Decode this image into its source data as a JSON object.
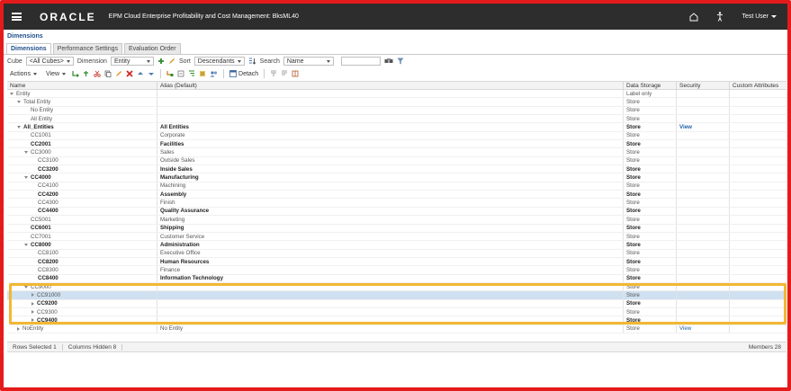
{
  "topbar": {
    "logo": "ORACLE",
    "app_title": "EPM Cloud Enterprise Profitability and Cost Management: BksML40",
    "user": "Test User"
  },
  "page_title": "Dimensions",
  "tabs": [
    {
      "label": "Dimensions",
      "active": true
    },
    {
      "label": "Performance Settings",
      "active": false
    },
    {
      "label": "Evaluation Order",
      "active": false
    }
  ],
  "filters": {
    "cube_label": "Cube",
    "cube_value": "<All Cubes>",
    "dimension_label": "Dimension",
    "dimension_value": "Entity",
    "sort_label": "Sort",
    "sort_value": "Descendants",
    "search_label": "Search",
    "search_value": "Name"
  },
  "toolbar": {
    "actions_label": "Actions",
    "view_label": "View",
    "detach_label": "Detach"
  },
  "table": {
    "columns": [
      "Name",
      "Alias (Default)",
      "Data Storage",
      "Security",
      "Custom Attributes"
    ],
    "rows": [
      {
        "name": "Entity",
        "alias": "",
        "storage": "Label only",
        "security": "",
        "level": 0,
        "toggle": "open",
        "bold": false,
        "selected": false
      },
      {
        "name": "Total Entity",
        "alias": "",
        "storage": "Store",
        "security": "",
        "level": 1,
        "toggle": "open",
        "bold": false,
        "selected": false
      },
      {
        "name": "No Entity",
        "alias": "",
        "storage": "Store",
        "security": "",
        "level": 2,
        "toggle": "none",
        "bold": false,
        "selected": false
      },
      {
        "name": "All Entity",
        "alias": "",
        "storage": "Store",
        "security": "",
        "level": 2,
        "toggle": "none",
        "bold": false,
        "selected": false
      },
      {
        "name": "All_Entities",
        "alias": "All Entities",
        "storage": "Store",
        "security": "View",
        "level": 1,
        "toggle": "open",
        "bold": true,
        "selected": false
      },
      {
        "name": "CC1001",
        "alias": "Corporate",
        "storage": "Store",
        "security": "",
        "level": 2,
        "toggle": "none",
        "bold": false,
        "selected": false
      },
      {
        "name": "CC2001",
        "alias": "Facilities",
        "storage": "Store",
        "security": "",
        "level": 2,
        "toggle": "none",
        "bold": true,
        "selected": false
      },
      {
        "name": "CC3000",
        "alias": "Sales",
        "storage": "Store",
        "security": "",
        "level": 2,
        "toggle": "open",
        "bold": false,
        "selected": false
      },
      {
        "name": "CC3100",
        "alias": "Outside Sales",
        "storage": "Store",
        "security": "",
        "level": 3,
        "toggle": "none",
        "bold": false,
        "selected": false
      },
      {
        "name": "CC3200",
        "alias": "Inside Sales",
        "storage": "Store",
        "security": "",
        "level": 3,
        "toggle": "none",
        "bold": true,
        "selected": false
      },
      {
        "name": "CC4000",
        "alias": "Manufacturing",
        "storage": "Store",
        "security": "",
        "level": 2,
        "toggle": "open",
        "bold": true,
        "selected": false
      },
      {
        "name": "CC4100",
        "alias": "Machining",
        "storage": "Store",
        "security": "",
        "level": 3,
        "toggle": "none",
        "bold": false,
        "selected": false
      },
      {
        "name": "CC4200",
        "alias": "Assembly",
        "storage": "Store",
        "security": "",
        "level": 3,
        "toggle": "none",
        "bold": true,
        "selected": false
      },
      {
        "name": "CC4300",
        "alias": "Finish",
        "storage": "Store",
        "security": "",
        "level": 3,
        "toggle": "none",
        "bold": false,
        "selected": false
      },
      {
        "name": "CC4400",
        "alias": "Quality Assurance",
        "storage": "Store",
        "security": "",
        "level": 3,
        "toggle": "none",
        "bold": true,
        "selected": false
      },
      {
        "name": "CC5001",
        "alias": "Marketing",
        "storage": "Store",
        "security": "",
        "level": 2,
        "toggle": "none",
        "bold": false,
        "selected": false
      },
      {
        "name": "CC6001",
        "alias": "Shipping",
        "storage": "Store",
        "security": "",
        "level": 2,
        "toggle": "none",
        "bold": true,
        "selected": false
      },
      {
        "name": "CC7001",
        "alias": "Customer Service",
        "storage": "Store",
        "security": "",
        "level": 2,
        "toggle": "none",
        "bold": false,
        "selected": false
      },
      {
        "name": "CC8000",
        "alias": "Administration",
        "storage": "Store",
        "security": "",
        "level": 2,
        "toggle": "open",
        "bold": true,
        "selected": false
      },
      {
        "name": "CC8100",
        "alias": "Executive Office",
        "storage": "Store",
        "security": "",
        "level": 3,
        "toggle": "none",
        "bold": false,
        "selected": false
      },
      {
        "name": "CC8200",
        "alias": "Human Resources",
        "storage": "Store",
        "security": "",
        "level": 3,
        "toggle": "none",
        "bold": true,
        "selected": false
      },
      {
        "name": "CC8300",
        "alias": "Finance",
        "storage": "Store",
        "security": "",
        "level": 3,
        "toggle": "none",
        "bold": false,
        "selected": false
      },
      {
        "name": "CC8400",
        "alias": "Information Technology",
        "storage": "Store",
        "security": "",
        "level": 3,
        "toggle": "none",
        "bold": true,
        "selected": false
      },
      {
        "name": "CC9000",
        "alias": "",
        "storage": "Store",
        "security": "",
        "level": 2,
        "toggle": "open",
        "bold": false,
        "selected": false
      },
      {
        "name": "CC91000",
        "alias": "",
        "storage": "Store",
        "security": "",
        "level": 3,
        "toggle": "closed",
        "bold": false,
        "selected": true
      },
      {
        "name": "CC9200",
        "alias": "",
        "storage": "Store",
        "security": "",
        "level": 3,
        "toggle": "closed",
        "bold": true,
        "selected": false
      },
      {
        "name": "CC9300",
        "alias": "",
        "storage": "Store",
        "security": "",
        "level": 3,
        "toggle": "closed",
        "bold": false,
        "selected": false
      },
      {
        "name": "CC9400",
        "alias": "",
        "storage": "Store",
        "security": "",
        "level": 3,
        "toggle": "closed",
        "bold": true,
        "selected": false
      },
      {
        "name": "NoEntity",
        "alias": "No Entity",
        "storage": "Store",
        "security": "View",
        "level": 1,
        "toggle": "closed",
        "bold": false,
        "selected": false
      }
    ]
  },
  "status": {
    "rows_selected": "Rows Selected 1",
    "columns_hidden": "Columns Hidden 8",
    "members": "Members 28"
  },
  "colors": {
    "frame": "#e31b1b",
    "highlight": "#f2b733",
    "topbar": "#2d2d2d",
    "selected_row": "#cfe0f1"
  }
}
